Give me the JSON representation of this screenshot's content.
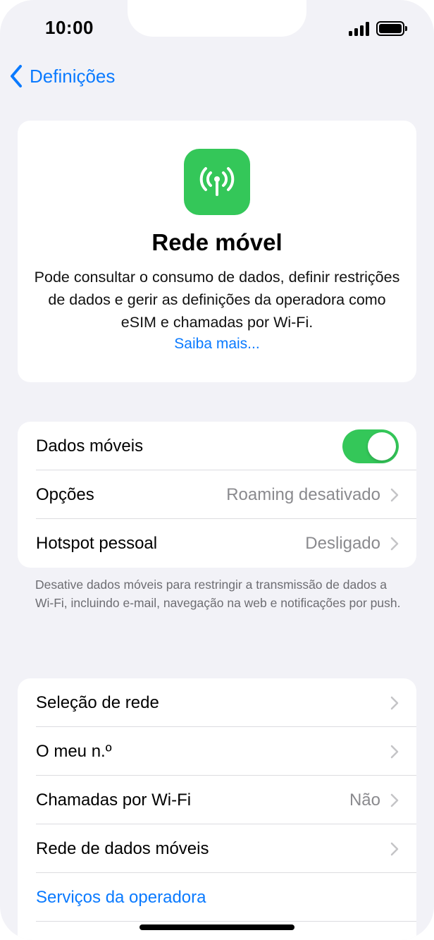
{
  "status_bar": {
    "time": "10:00"
  },
  "nav": {
    "back_label": "Definições"
  },
  "header": {
    "icon": "antenna-icon",
    "icon_color": "#34c759",
    "title": "Rede móvel",
    "description": "Pode consultar o consumo de dados, definir restrições de dados e gerir as definições da operadora como eSIM e chamadas por Wi-Fi.",
    "learn_more": "Saiba mais..."
  },
  "group1": {
    "mobile_data": {
      "label": "Dados móveis",
      "enabled": true
    },
    "options": {
      "label": "Opções",
      "value": "Roaming desativado"
    },
    "hotspot": {
      "label": "Hotspot pessoal",
      "value": "Desligado"
    },
    "footnote": "Desative dados móveis para restringir a transmissão de dados a Wi-Fi, incluindo e-mail, navegação na web e notificações por push."
  },
  "group2": {
    "network_selection": {
      "label": "Seleção de rede"
    },
    "my_number": {
      "label": "O meu n.º"
    },
    "wifi_calling": {
      "label": "Chamadas por Wi-Fi",
      "value": "Não"
    },
    "mobile_data_network": {
      "label": "Rede de dados móveis"
    },
    "carrier_services": {
      "label": "Serviços da operadora"
    }
  },
  "colors": {
    "accent": "#0a7aff",
    "toggle_on": "#34c759",
    "background": "#f2f2f7"
  }
}
